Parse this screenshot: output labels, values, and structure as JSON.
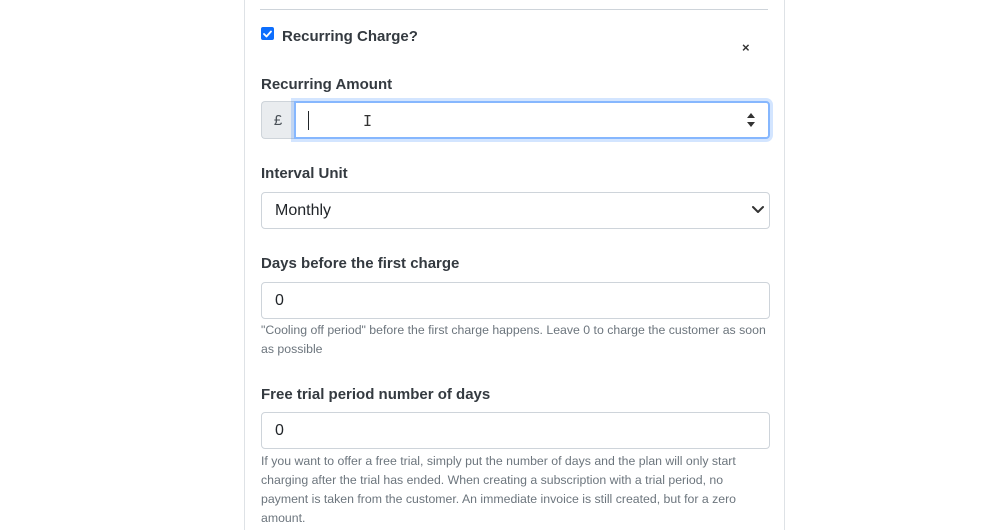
{
  "form": {
    "recurring_checkbox": {
      "label": "Recurring Charge?",
      "checked": true
    },
    "close_symbol": "×",
    "recurring_amount": {
      "label": "Recurring Amount",
      "currency_prefix": "£",
      "value": ""
    },
    "interval_unit": {
      "label": "Interval Unit",
      "selected": "Monthly"
    },
    "days_before_first_charge": {
      "label": "Days before the first charge",
      "value": "0",
      "help": "\"Cooling off period\" before the first charge happens. Leave 0 to charge the customer as soon as possible"
    },
    "free_trial_days": {
      "label": "Free trial period number of days",
      "value": "0",
      "help": "If you want to offer a free trial, simply put the number of days and the plan will only start charging after the trial has ended. When creating a subscription with a trial period, no payment is taken from the customer. An immediate invoice is still created, but for a zero amount."
    }
  },
  "colors": {
    "checkbox": "#0d6efd",
    "focus_border": "#86b7fe",
    "help_text": "#6c757d"
  }
}
